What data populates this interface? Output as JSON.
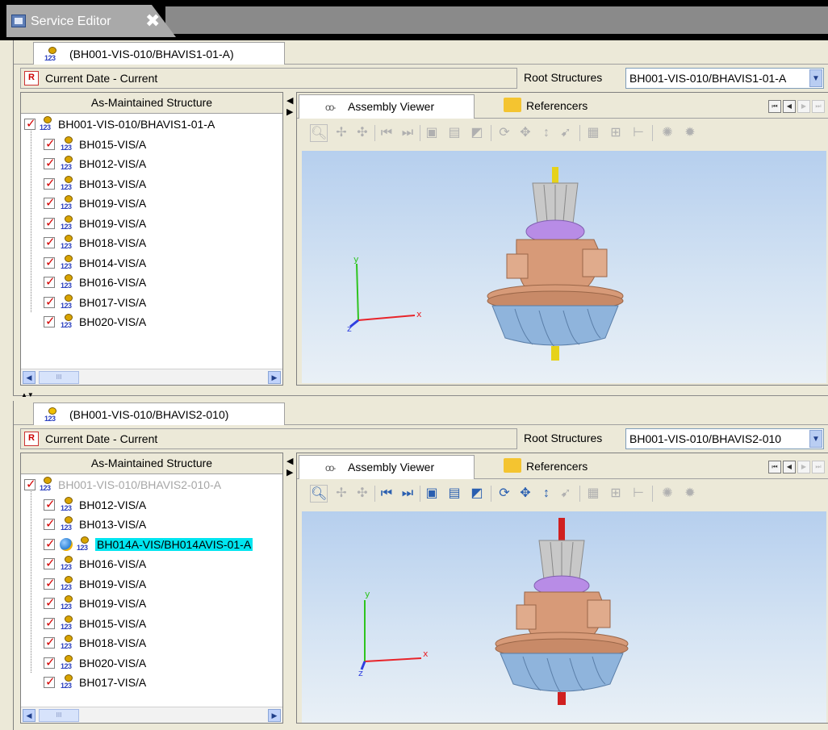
{
  "editor_tab": {
    "title": "Service Editor",
    "close_glyph": "✖",
    "icon": "service-editor-icon"
  },
  "panels": [
    {
      "sub_tab": "(BH001-VIS-010/BHAVIS1-01-A)",
      "date": "Current Date - Current",
      "root_label": "Root Structures",
      "root_value": "BH001-VIS-010/BHAVIS1-01-A",
      "tree_header": "As-Maintained Structure",
      "tree_root": "BH001-VIS-010/BHAVIS1-01-A",
      "tree_items": [
        "BH015-VIS/A",
        "BH012-VIS/A",
        "BH013-VIS/A",
        "BH019-VIS/A",
        "BH019-VIS/A",
        "BH018-VIS/A",
        "BH014-VIS/A",
        "BH016-VIS/A",
        "BH017-VIS/A",
        "BH020-VIS/A"
      ],
      "viewer_tabs": [
        "Assembly Viewer",
        "Referencers"
      ]
    },
    {
      "sub_tab": "(BH001-VIS-010/BHAVIS2-010)",
      "date": "Current Date - Current",
      "root_label": "Root Structures",
      "root_value": "BH001-VIS-010/BHAVIS2-010",
      "tree_header": "As-Maintained Structure",
      "tree_root": "BH001-VIS-010/BHAVIS2-010-A",
      "tree_selected": "BH014A-VIS/BH014AVIS-01-A",
      "tree_items": [
        "BH012-VIS/A",
        "BH013-VIS/A",
        "BH016-VIS/A",
        "BH019-VIS/A",
        "BH019-VIS/A",
        "BH015-VIS/A",
        "BH018-VIS/A",
        "BH020-VIS/A",
        "BH017-VIS/A"
      ],
      "viewer_tabs": [
        "Assembly Viewer",
        "Referencers"
      ]
    }
  ],
  "axes": {
    "x": "x",
    "y": "y",
    "z": "z"
  },
  "colors": {
    "axis_x": "#e8242a",
    "axis_y": "#2ec41f",
    "axis_z": "#2f3fe0",
    "part_copper": "#d79a78",
    "part_blue": "#8fb4dc",
    "part_purple": "#b88ce6",
    "shaft_top": "#e6d21a",
    "shaft_bottom": "#d02020",
    "selection": "#00e5f0"
  }
}
